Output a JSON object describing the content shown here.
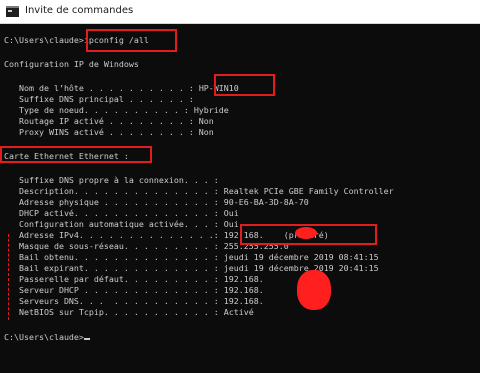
{
  "window": {
    "title": "Invite de commandes"
  },
  "console": {
    "prompt1": "C:\\Users\\claude>",
    "command": "ipconfig /all",
    "config_title": "Configuration IP de Windows",
    "host": {
      "label": "   Nom de l’hôte . . . . . . . . . . : ",
      "value": "HP-WIN10"
    },
    "dns_suffix": "   Suffixe DNS principal . . . . . . : ",
    "node_type": "   Type de noeud. . . . . . . . . . : Hybride",
    "ip_routing": "   Routage IP activé . . . . . . . . : Non",
    "wins_proxy": "   Proxy WINS activé . . . . . . . . : Non",
    "adapter_title": "Carte Ethernet Ethernet :",
    "conn_dns_suffix": "   Suffixe DNS propre à la connexion. . . :",
    "description": "   Description. . . . . . . . . . . . . . : Realtek PCIe GBE Family Controller",
    "physical_address": "   Adresse physique . . . . . . . . . . . : 90-E6-BA-3D-8A-70",
    "dhcp_enabled": "   DHCP activé. . . . . . . . . . . . . . : Oui",
    "autoconfig": "   Configuration automatique activée. . . : Oui",
    "ipv4": {
      "label": "   Adresse IPv4. . . . . . . . . . . . . .: ",
      "value": "192.168.",
      "suffix": "(préféré)"
    },
    "subnet_mask": "   Masque de sous-réseau. . . . . . . . . : 255.255.255.0",
    "lease_obtained": "   Bail obtenu. . . . . . . . . . . . . . : jeudi 19 décembre 2019 08:41:15",
    "lease_expires": "   Bail expirant. . . . . . . . . . . . . : jeudi 19 décembre 2019 20:41:15",
    "gateway": "   Passerelle par défaut. . . . . . . . . : 192.168.",
    "dhcp_server": "   Serveur DHCP . . . . . . . . . . . . . : 192.168.",
    "dns_servers": "   Serveurs DNS. . .  . . . . . . . . . . : 192.168.",
    "netbios": "   NetBIOS sur Tcpip. . . . . . . . . . . : Activé",
    "prompt2": "C:\\Users\\claude>"
  },
  "colors": {
    "background": "#0c0c0c",
    "text": "#cccccc",
    "annotation": "#e01e1e"
  }
}
